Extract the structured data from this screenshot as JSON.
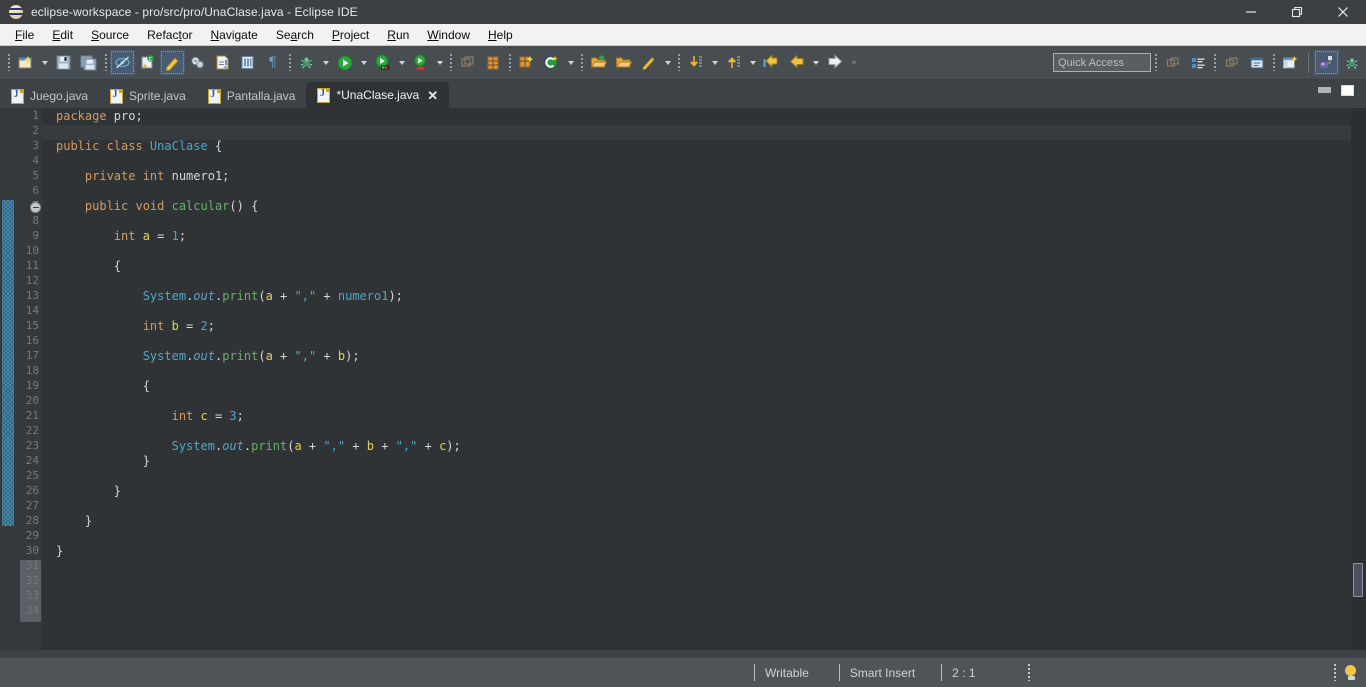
{
  "window": {
    "title": "eclipse-workspace - pro/src/pro/UnaClase.java - Eclipse IDE",
    "logo_icon": "eclipse-logo-icon",
    "minimize_icon": "minimize-icon",
    "restore_icon": "restore-icon",
    "close_icon": "close-icon"
  },
  "menubar": {
    "items": [
      {
        "label": "File",
        "mnemonic": "F"
      },
      {
        "label": "Edit",
        "mnemonic": "E"
      },
      {
        "label": "Source",
        "mnemonic": "S"
      },
      {
        "label": "Refactor",
        "mnemonic": "t"
      },
      {
        "label": "Navigate",
        "mnemonic": "N"
      },
      {
        "label": "Search",
        "mnemonic": "a"
      },
      {
        "label": "Project",
        "mnemonic": "P"
      },
      {
        "label": "Run",
        "mnemonic": "R"
      },
      {
        "label": "Window",
        "mnemonic": "W"
      },
      {
        "label": "Help",
        "mnemonic": "H"
      }
    ]
  },
  "toolbar": {
    "buttons": [
      {
        "name": "new-wizard-icon",
        "title": "New"
      },
      {
        "name": "save-icon",
        "title": "Save"
      },
      {
        "name": "save-all-icon",
        "title": "Save All"
      },
      {
        "name": "toggle-breakpoint-skip-icon",
        "title": "Skip All Breakpoints"
      },
      {
        "name": "new-java-class-icon",
        "title": "New Java Class"
      },
      {
        "name": "marker-highlight-icon",
        "title": "Toggle Mark Occurrences"
      },
      {
        "name": "clean-build-icon",
        "title": "Build"
      },
      {
        "name": "open-type-icon",
        "title": "Open Type"
      },
      {
        "name": "open-task-icon",
        "title": "Open Task"
      },
      {
        "name": "pilcrow-icon",
        "title": "Show Whitespace Characters"
      },
      {
        "name": "debug-icon",
        "title": "Debug"
      },
      {
        "name": "run-icon",
        "title": "Run"
      },
      {
        "name": "run-configurations-icon",
        "title": "Run As"
      },
      {
        "name": "coverage-icon",
        "title": "Coverage"
      },
      {
        "name": "external-tools-icon",
        "title": "External Tools"
      },
      {
        "name": "table-grid-icon",
        "title": "Toggle Table"
      },
      {
        "name": "new-package-icon",
        "title": "New Package"
      },
      {
        "name": "search-c-icon",
        "title": "Search"
      },
      {
        "name": "open-folder-green-icon",
        "title": "Open Resource"
      },
      {
        "name": "open-folder-icon",
        "title": "Open File"
      },
      {
        "name": "pencil-icon",
        "title": "Edit"
      },
      {
        "name": "next-annotation-icon",
        "title": "Next Annotation"
      },
      {
        "name": "previous-annotation-icon",
        "title": "Previous Annotation"
      },
      {
        "name": "back-last-edit-icon",
        "title": "Last Edit Location"
      },
      {
        "name": "back-icon",
        "title": "Back"
      },
      {
        "name": "forward-icon",
        "title": "Forward"
      }
    ],
    "quick_access": {
      "placeholder": "Quick Access",
      "value": ""
    },
    "perspective_buttons": [
      {
        "name": "restore-perspective-icon",
        "title": "Restore"
      },
      {
        "name": "outline-view-icon",
        "title": "Outline"
      },
      {
        "name": "minimize-view-icon",
        "title": "Minimize"
      },
      {
        "name": "console-view-icon",
        "title": "Console"
      },
      {
        "name": "open-perspective-icon",
        "title": "Open Perspective"
      },
      {
        "name": "java-perspective-icon",
        "title": "Java"
      },
      {
        "name": "debug-perspective-icon",
        "title": "Debug"
      }
    ]
  },
  "editor_tabs": {
    "tabs": [
      {
        "label": "Juego.java",
        "active": false,
        "dirty": false,
        "icon": "java-file-icon"
      },
      {
        "label": "Sprite.java",
        "active": false,
        "dirty": false,
        "icon": "java-file-icon"
      },
      {
        "label": "Pantalla.java",
        "active": false,
        "dirty": false,
        "icon": "java-file-icon"
      },
      {
        "label": "*UnaClase.java",
        "active": true,
        "dirty": true,
        "icon": "java-file-icon",
        "close_icon": "close-tab-icon"
      }
    ],
    "minimize_label": "minimize-editor-icon",
    "maximize_label": "maximize-editor-icon"
  },
  "code": {
    "first_line": 1,
    "last_line": 30,
    "visible_gutter_last": 34,
    "fold_marker_line": 7,
    "lines": [
      {
        "n": 1,
        "tokens": [
          {
            "t": "package ",
            "c": "kw"
          },
          {
            "t": "pro;",
            "c": "pl"
          }
        ]
      },
      {
        "n": 2,
        "tokens": [],
        "highlight": true
      },
      {
        "n": 3,
        "tokens": [
          {
            "t": "public class ",
            "c": "kw"
          },
          {
            "t": "UnaClase",
            "c": "cls"
          },
          {
            "t": " {",
            "c": "pl"
          }
        ]
      },
      {
        "n": 4,
        "tokens": []
      },
      {
        "n": 5,
        "tokens": [
          {
            "t": "    private int ",
            "c": "kw"
          },
          {
            "t": "numero1;",
            "c": "pl"
          }
        ]
      },
      {
        "n": 6,
        "tokens": []
      },
      {
        "n": 7,
        "tokens": [
          {
            "t": "    public void ",
            "c": "kw"
          },
          {
            "t": "calcular",
            "c": "mth"
          },
          {
            "t": "() {",
            "c": "pl"
          }
        ]
      },
      {
        "n": 8,
        "tokens": []
      },
      {
        "n": 9,
        "tokens": [
          {
            "t": "        int ",
            "c": "kw"
          },
          {
            "t": "a",
            "c": "loc"
          },
          {
            "t": " = ",
            "c": "pl"
          },
          {
            "t": "1",
            "c": "num"
          },
          {
            "t": ";",
            "c": "pl"
          }
        ]
      },
      {
        "n": 10,
        "tokens": []
      },
      {
        "n": 11,
        "tokens": [
          {
            "t": "        {",
            "c": "pl"
          }
        ]
      },
      {
        "n": 12,
        "tokens": []
      },
      {
        "n": 13,
        "tokens": [
          {
            "t": "            ",
            "c": "pl"
          },
          {
            "t": "System",
            "c": "cls"
          },
          {
            "t": ".",
            "c": "pl"
          },
          {
            "t": "out",
            "c": "ital"
          },
          {
            "t": ".",
            "c": "pl"
          },
          {
            "t": "print",
            "c": "mth"
          },
          {
            "t": "(",
            "c": "pl"
          },
          {
            "t": "a",
            "c": "loc"
          },
          {
            "t": " + ",
            "c": "pl"
          },
          {
            "t": "\",\"",
            "c": "str"
          },
          {
            "t": " + ",
            "c": "pl"
          },
          {
            "t": "numero1",
            "c": "fld"
          },
          {
            "t": ");",
            "c": "pl"
          }
        ]
      },
      {
        "n": 14,
        "tokens": []
      },
      {
        "n": 15,
        "tokens": [
          {
            "t": "            int ",
            "c": "kw"
          },
          {
            "t": "b",
            "c": "loc"
          },
          {
            "t": " = ",
            "c": "pl"
          },
          {
            "t": "2",
            "c": "num"
          },
          {
            "t": ";",
            "c": "pl"
          }
        ]
      },
      {
        "n": 16,
        "tokens": []
      },
      {
        "n": 17,
        "tokens": [
          {
            "t": "            ",
            "c": "pl"
          },
          {
            "t": "System",
            "c": "cls"
          },
          {
            "t": ".",
            "c": "pl"
          },
          {
            "t": "out",
            "c": "ital"
          },
          {
            "t": ".",
            "c": "pl"
          },
          {
            "t": "print",
            "c": "mth"
          },
          {
            "t": "(",
            "c": "pl"
          },
          {
            "t": "a",
            "c": "loc"
          },
          {
            "t": " + ",
            "c": "pl"
          },
          {
            "t": "\",\"",
            "c": "str"
          },
          {
            "t": " + ",
            "c": "pl"
          },
          {
            "t": "b",
            "c": "loc"
          },
          {
            "t": ");",
            "c": "pl"
          }
        ]
      },
      {
        "n": 18,
        "tokens": []
      },
      {
        "n": 19,
        "tokens": [
          {
            "t": "            {",
            "c": "pl"
          }
        ]
      },
      {
        "n": 20,
        "tokens": []
      },
      {
        "n": 21,
        "tokens": [
          {
            "t": "                int ",
            "c": "kw"
          },
          {
            "t": "c",
            "c": "loc"
          },
          {
            "t": " = ",
            "c": "pl"
          },
          {
            "t": "3",
            "c": "num"
          },
          {
            "t": ";",
            "c": "pl"
          }
        ]
      },
      {
        "n": 22,
        "tokens": []
      },
      {
        "n": 23,
        "tokens": [
          {
            "t": "                ",
            "c": "pl"
          },
          {
            "t": "System",
            "c": "cls"
          },
          {
            "t": ".",
            "c": "pl"
          },
          {
            "t": "out",
            "c": "ital"
          },
          {
            "t": ".",
            "c": "pl"
          },
          {
            "t": "print",
            "c": "mth"
          },
          {
            "t": "(",
            "c": "pl"
          },
          {
            "t": "a",
            "c": "loc"
          },
          {
            "t": " + ",
            "c": "pl"
          },
          {
            "t": "\",\"",
            "c": "str"
          },
          {
            "t": " + ",
            "c": "pl"
          },
          {
            "t": "b",
            "c": "loc"
          },
          {
            "t": " + ",
            "c": "pl"
          },
          {
            "t": "\",\"",
            "c": "str"
          },
          {
            "t": " + ",
            "c": "pl"
          },
          {
            "t": "c",
            "c": "loc"
          },
          {
            "t": ");",
            "c": "pl"
          }
        ]
      },
      {
        "n": 24,
        "tokens": [
          {
            "t": "            }",
            "c": "pl"
          }
        ]
      },
      {
        "n": 25,
        "tokens": []
      },
      {
        "n": 26,
        "tokens": [
          {
            "t": "        }",
            "c": "pl"
          }
        ]
      },
      {
        "n": 27,
        "tokens": []
      },
      {
        "n": 28,
        "tokens": [
          {
            "t": "    }",
            "c": "pl"
          }
        ]
      },
      {
        "n": 29,
        "tokens": []
      },
      {
        "n": 30,
        "tokens": [
          {
            "t": "}",
            "c": "pl"
          }
        ]
      }
    ]
  },
  "statusbar": {
    "writable": "Writable",
    "insert_mode": "Smart Insert",
    "position": "2 : 1",
    "bulb_icon": "quick-fix-bulb-icon"
  },
  "colors": {
    "titlebar_bg": "#3c4043",
    "menubar_bg": "#f2f2f2",
    "toolbar_bg": "#474d50",
    "editor_bg": "#2f3335",
    "gutter_bg": "#343a3c",
    "statusbar_bg": "#4e5457",
    "keyword": "#d79b5c",
    "class": "#4ea7cc",
    "method": "#64b568",
    "local_var": "#e3d54a",
    "string": "#4ea7cc",
    "plain": "#d6d6d6",
    "line_number": "#737b7e",
    "fold_bar": "#2f6b8c"
  }
}
